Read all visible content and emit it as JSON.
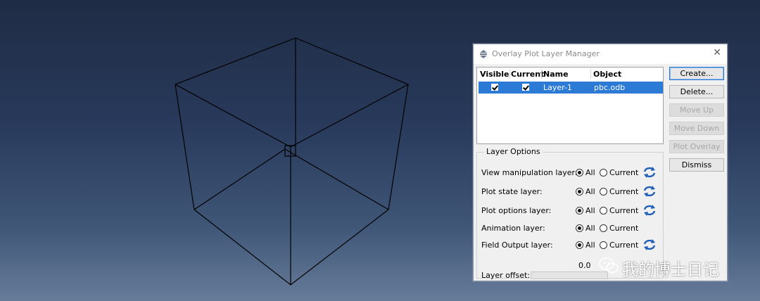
{
  "dialog": {
    "title": "Overlay Plot Layer Manager",
    "close_glyph": "✕"
  },
  "table": {
    "headers": {
      "visible": "Visible",
      "current": "Current",
      "name": "Name",
      "object": "Object"
    },
    "rows": [
      {
        "visible": true,
        "current": true,
        "name": "Layer-1",
        "object": "pbc.odb"
      }
    ]
  },
  "buttons": {
    "create": "Create...",
    "delete": "Delete...",
    "move_up": "Move Up",
    "move_down": "Move Down",
    "plot_overlay": "Plot Overlay",
    "dismiss": "Dismiss"
  },
  "layer_options": {
    "legend": "Layer Options",
    "all_label": "All",
    "current_label": "Current",
    "rows": [
      {
        "label": "View manipulation layer:",
        "selected": "All",
        "sync_icon": "sync-icon"
      },
      {
        "label": "Plot state layer:",
        "selected": "All",
        "sync_icon": "sync-icon"
      },
      {
        "label": "Plot options layer:",
        "selected": "All",
        "sync_icon": "sync-icon"
      },
      {
        "label": "Animation layer:",
        "selected": "All",
        "sync_icon": ""
      },
      {
        "label": "Field Output layer:",
        "selected": "All",
        "sync_icon": "sync-icon"
      }
    ],
    "offset_label": "Layer offset:",
    "offset_value": "0.0"
  },
  "watermark": {
    "text": "我的博士日记"
  },
  "colors": {
    "selection": "#2a7ad6",
    "sync_icon": "#1f5fb8",
    "cube_edges": "#000000"
  }
}
